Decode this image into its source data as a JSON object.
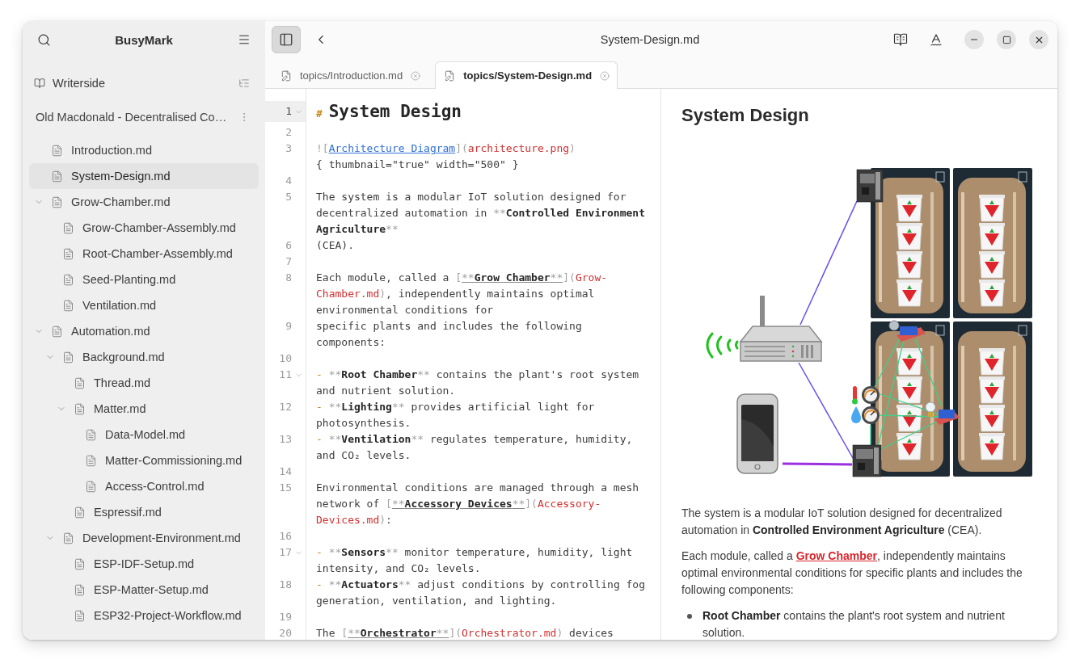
{
  "window": {
    "title": "System-Design.md"
  },
  "sidebar": {
    "app_title": "BusyMark",
    "workspace": {
      "label": "Writerside"
    },
    "project": {
      "title": "Old Macdonald - Decentralised Co…"
    },
    "tree": [
      {
        "label": "Introduction.md",
        "selected": false
      },
      {
        "label": "System-Design.md",
        "selected": true
      },
      {
        "label": "Grow-Chamber.md",
        "selected": false,
        "expanded": true,
        "children": [
          {
            "label": "Grow-Chamber-Assembly.md",
            "selected": false
          },
          {
            "label": "Root-Chamber-Assembly.md",
            "selected": false
          },
          {
            "label": "Seed-Planting.md",
            "selected": false
          },
          {
            "label": "Ventilation.md",
            "selected": false
          }
        ]
      },
      {
        "label": "Automation.md",
        "selected": false,
        "expanded": true,
        "children": [
          {
            "label": "Background.md",
            "selected": false,
            "expanded": true,
            "children": [
              {
                "label": "Thread.md",
                "selected": false
              },
              {
                "label": "Matter.md",
                "selected": false,
                "expanded": true,
                "children": [
                  {
                    "label": "Data-Model.md",
                    "selected": false
                  },
                  {
                    "label": "Matter-Commissioning.md",
                    "selected": false
                  },
                  {
                    "label": "Access-Control.md",
                    "selected": false
                  }
                ]
              },
              {
                "label": "Espressif.md",
                "selected": false
              }
            ]
          },
          {
            "label": "Development-Environment.md",
            "selected": false,
            "expanded": true,
            "children": [
              {
                "label": "ESP-IDF-Setup.md",
                "selected": false
              },
              {
                "label": "ESP-Matter-Setup.md",
                "selected": false
              },
              {
                "label": "ESP32-Project-Workflow.md",
                "selected": false
              }
            ]
          }
        ]
      }
    ]
  },
  "headerbar": {
    "sidebar_toggle": {
      "pressed": true
    }
  },
  "tabs": [
    {
      "label": "topics/Introduction.md",
      "selected": false
    },
    {
      "label": "topics/System-Design.md",
      "selected": true
    }
  ],
  "editor": {
    "lines": [
      {
        "number": "1",
        "active": true,
        "foldable": true,
        "segments": [
          {
            "kind": "heading-mark",
            "text": "# "
          },
          {
            "kind": "heading",
            "text": "System Design"
          }
        ]
      },
      {
        "number": "2",
        "active": false,
        "foldable": false
      },
      {
        "number": "3",
        "active": false,
        "foldable": false,
        "segments": [
          {
            "kind": "mark",
            "text": "!["
          },
          {
            "kind": "link-text",
            "text": "Architecture Diagram"
          },
          {
            "kind": "mark",
            "text": "]("
          },
          {
            "kind": "url",
            "text": "architecture.png"
          },
          {
            "kind": "mark",
            "text": ") "
          },
          {
            "kind": "attr",
            "text": "{ thumbnail=\"true\" width=\"500\" }"
          }
        ]
      },
      {
        "number": "4",
        "active": false,
        "foldable": false
      },
      {
        "number": "5",
        "active": false,
        "foldable": false,
        "segments": [
          {
            "kind": "plain",
            "text": "The system is a modular IoT solution designed for decentralized automation in "
          },
          {
            "kind": "mark",
            "text": "**"
          },
          {
            "kind": "bold",
            "text": "Controlled Environment Agriculture"
          },
          {
            "kind": "mark",
            "text": "**"
          }
        ]
      },
      {
        "number": "6",
        "active": false,
        "foldable": false,
        "segments": [
          {
            "kind": "plain",
            "text": "(CEA)."
          }
        ]
      },
      {
        "number": "7",
        "active": false,
        "foldable": false
      },
      {
        "number": "8",
        "active": false,
        "foldable": false,
        "segments": [
          {
            "kind": "plain",
            "text": "Each module, called a "
          },
          {
            "kind": "mark",
            "text": "["
          },
          {
            "kind": "link-mark",
            "text": "**"
          },
          {
            "kind": "bold-link",
            "text": "Grow Chamber"
          },
          {
            "kind": "link-mark",
            "text": "**"
          },
          {
            "kind": "mark",
            "text": "]("
          },
          {
            "kind": "url",
            "text": "Grow-Chamber.md"
          },
          {
            "kind": "mark",
            "text": ")"
          },
          {
            "kind": "plain",
            "text": ", independently maintains optimal environmental conditions for"
          }
        ]
      },
      {
        "number": "9",
        "active": false,
        "foldable": false,
        "segments": [
          {
            "kind": "plain",
            "text": "specific plants and includes the following components:"
          }
        ]
      },
      {
        "number": "10",
        "active": false,
        "foldable": false
      },
      {
        "number": "11",
        "active": false,
        "foldable": true,
        "segments": [
          {
            "kind": "bullet",
            "text": "- "
          },
          {
            "kind": "mark",
            "text": "**"
          },
          {
            "kind": "bold",
            "text": "Root Chamber"
          },
          {
            "kind": "mark",
            "text": "**"
          },
          {
            "kind": "plain",
            "text": " contains the plant's root system and nutrient solution."
          }
        ]
      },
      {
        "number": "12",
        "active": false,
        "foldable": false,
        "segments": [
          {
            "kind": "bullet",
            "text": "- "
          },
          {
            "kind": "mark",
            "text": "**"
          },
          {
            "kind": "bold",
            "text": "Lighting"
          },
          {
            "kind": "mark",
            "text": "**"
          },
          {
            "kind": "plain",
            "text": " provides artificial light for photosynthesis."
          }
        ]
      },
      {
        "number": "13",
        "active": false,
        "foldable": false,
        "segments": [
          {
            "kind": "bullet",
            "text": "- "
          },
          {
            "kind": "mark",
            "text": "**"
          },
          {
            "kind": "bold",
            "text": "Ventilation"
          },
          {
            "kind": "mark",
            "text": "**"
          },
          {
            "kind": "plain",
            "text": " regulates temperature, humidity, and CO₂ levels."
          }
        ]
      },
      {
        "number": "14",
        "active": false,
        "foldable": false
      },
      {
        "number": "15",
        "active": false,
        "foldable": false,
        "segments": [
          {
            "kind": "plain",
            "text": "Environmental conditions are managed through a mesh network of "
          },
          {
            "kind": "mark",
            "text": "["
          },
          {
            "kind": "link-mark",
            "text": "**"
          },
          {
            "kind": "bold-link",
            "text": "Accessory Devices"
          },
          {
            "kind": "link-mark",
            "text": "**"
          },
          {
            "kind": "mark",
            "text": "]("
          },
          {
            "kind": "url",
            "text": "Accessory-Devices.md"
          },
          {
            "kind": "mark",
            "text": ")"
          },
          {
            "kind": "plain",
            "text": ":"
          }
        ]
      },
      {
        "number": "16",
        "active": false,
        "foldable": false
      },
      {
        "number": "17",
        "active": false,
        "foldable": true,
        "segments": [
          {
            "kind": "bullet",
            "text": "- "
          },
          {
            "kind": "mark",
            "text": "**"
          },
          {
            "kind": "bold",
            "text": "Sensors"
          },
          {
            "kind": "mark",
            "text": "**"
          },
          {
            "kind": "plain",
            "text": " monitor temperature, humidity, light intensity, and CO₂ levels."
          }
        ]
      },
      {
        "number": "18",
        "active": false,
        "foldable": false,
        "segments": [
          {
            "kind": "bullet",
            "text": "- "
          },
          {
            "kind": "mark",
            "text": "**"
          },
          {
            "kind": "bold",
            "text": "Actuators"
          },
          {
            "kind": "mark",
            "text": "**"
          },
          {
            "kind": "plain",
            "text": " adjust conditions by controlling fog generation, ventilation, and lighting."
          }
        ]
      },
      {
        "number": "19",
        "active": false,
        "foldable": false
      },
      {
        "number": "20",
        "active": false,
        "foldable": false,
        "segments": [
          {
            "kind": "plain",
            "text": "The "
          },
          {
            "kind": "mark",
            "text": "["
          },
          {
            "kind": "link-mark",
            "text": "**"
          },
          {
            "kind": "bold-link",
            "text": "Orchestrator"
          },
          {
            "kind": "link-mark",
            "text": "**"
          },
          {
            "kind": "mark",
            "text": "]("
          },
          {
            "kind": "url",
            "text": "Orchestrator.md"
          },
          {
            "kind": "mark",
            "text": ")"
          },
          {
            "kind": "plain",
            "text": " devices"
          }
        ]
      }
    ]
  },
  "preview": {
    "heading": "System Design",
    "paragraphs": [
      {
        "text": "The system is a modular IoT solution designed for decentralized automation in **Controlled Environment Agriculture** (CEA)."
      },
      {
        "text": "Each module, called a ",
        "link": "Grow Chamber",
        "after": ", independently maintains optimal environmental conditions for specific plants and includes the following components:"
      }
    ],
    "bullets": [
      {
        "text": "**Root Chamber** contains the plant's root system and nutrient solution."
      }
    ]
  }
}
